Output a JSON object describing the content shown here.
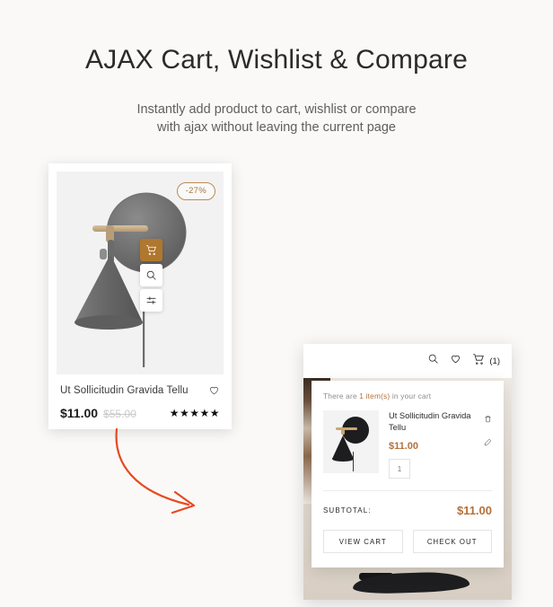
{
  "header": {
    "title": "AJAX Cart, Wishlist & Compare",
    "subtitle_line1": "Instantly add product to cart, wishlist or compare",
    "subtitle_line2": "with ajax without leaving the current page"
  },
  "product_card": {
    "discount_badge": "-27%",
    "name": "Ut Sollicitudin Gravida Tellu",
    "price_current": "$11.00",
    "price_old": "$55.00",
    "rating_stars": "★★★★★",
    "actions": [
      {
        "name": "add-to-cart",
        "icon": "cart-icon"
      },
      {
        "name": "quick-view",
        "icon": "search-icon"
      },
      {
        "name": "compare",
        "icon": "sliders-icon"
      }
    ],
    "wishlist_icon": "heart-icon"
  },
  "cart_mockup": {
    "topbar": {
      "search_icon": "search-icon",
      "wishlist_icon": "heart-icon",
      "cart_icon": "cart-icon",
      "cart_count": "(1)"
    },
    "dropdown": {
      "note_prefix": "There are ",
      "note_highlight": "1 item(s)",
      "note_suffix": " in your cart",
      "item": {
        "name": "Ut Sollicitudin Gravida Tellu",
        "price": "$11.00",
        "quantity": "1",
        "remove_icon": "trash-icon",
        "edit_icon": "pencil-icon"
      },
      "subtotal_label": "SUBTOTAL:",
      "subtotal_value": "$11.00",
      "view_cart_label": "VIEW CART",
      "checkout_label": "CHECK OUT"
    }
  },
  "colors": {
    "page_background": "#faf9f7",
    "accent_orange": "#b5703a",
    "cart_button": "#b0772f",
    "arrow": "#e8491f",
    "badge_border": "#bb8b55"
  },
  "arrow": {
    "icon": "curved-arrow-icon"
  }
}
